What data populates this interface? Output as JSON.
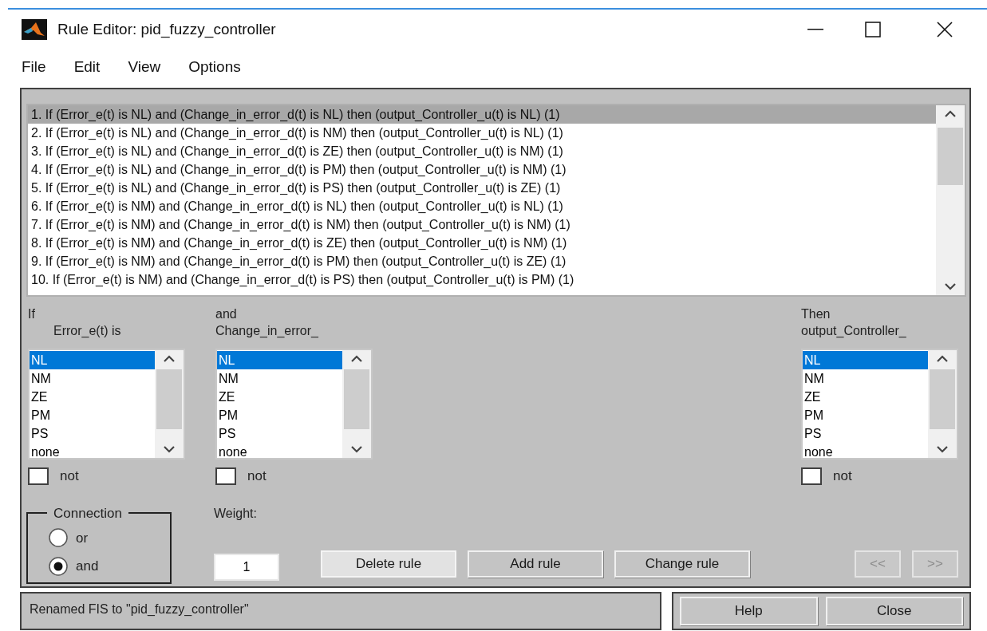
{
  "window": {
    "title": "Rule Editor: pid_fuzzy_controller"
  },
  "menu": [
    "File",
    "Edit",
    "View",
    "Options"
  ],
  "rules": [
    {
      "text": "1. If (Error_e(t) is NL) and (Change_in_error_d(t) is NL) then (output_Controller_u(t) is NL) (1)",
      "selected": true
    },
    {
      "text": "2. If (Error_e(t) is NL) and (Change_in_error_d(t) is NM) then (output_Controller_u(t) is NL) (1)",
      "selected": false
    },
    {
      "text": "3. If (Error_e(t) is NL) and (Change_in_error_d(t) is ZE) then (output_Controller_u(t) is NM) (1)",
      "selected": false
    },
    {
      "text": "4. If (Error_e(t) is NL) and (Change_in_error_d(t) is PM) then (output_Controller_u(t) is NM) (1)",
      "selected": false
    },
    {
      "text": "5. If (Error_e(t) is NL) and (Change_in_error_d(t) is PS) then (output_Controller_u(t) is ZE) (1)",
      "selected": false
    },
    {
      "text": "6. If (Error_e(t) is NM) and (Change_in_error_d(t) is NL) then (output_Controller_u(t) is NL) (1)",
      "selected": false
    },
    {
      "text": "7. If (Error_e(t) is NM) and (Change_in_error_d(t) is NM) then (output_Controller_u(t) is NM) (1)",
      "selected": false
    },
    {
      "text": "8. If (Error_e(t) is NM) and (Change_in_error_d(t) is ZE) then (output_Controller_u(t) is NM) (1)",
      "selected": false
    },
    {
      "text": "9. If (Error_e(t) is NM) and (Change_in_error_d(t) is PM) then (output_Controller_u(t) is ZE) (1)",
      "selected": false
    },
    {
      "text": "10. If (Error_e(t) is NM) and (Change_in_error_d(t) is PS) then (output_Controller_u(t) is PM) (1)",
      "selected": false
    }
  ],
  "variables": [
    {
      "kind": "input",
      "heading": "If",
      "variable": "Error_e(t) is",
      "items": [
        {
          "label": "NL",
          "selected": true
        },
        {
          "label": "NM",
          "selected": false
        },
        {
          "label": "ZE",
          "selected": false
        },
        {
          "label": "PM",
          "selected": false
        },
        {
          "label": "PS",
          "selected": false
        },
        {
          "label": "none",
          "selected": false
        }
      ],
      "not": {
        "label": "not",
        "checked": false
      }
    },
    {
      "kind": "input",
      "heading": "and",
      "variable": "Change_in_error_",
      "items": [
        {
          "label": "NL",
          "selected": true
        },
        {
          "label": "NM",
          "selected": false
        },
        {
          "label": "ZE",
          "selected": false
        },
        {
          "label": "PM",
          "selected": false
        },
        {
          "label": "PS",
          "selected": false
        },
        {
          "label": "none",
          "selected": false
        }
      ],
      "not": {
        "label": "not",
        "checked": false
      }
    },
    {
      "kind": "output",
      "heading": "Then",
      "variable": "output_Controller_",
      "items": [
        {
          "label": "NL",
          "selected": true
        },
        {
          "label": "NM",
          "selected": false
        },
        {
          "label": "ZE",
          "selected": false
        },
        {
          "label": "PM",
          "selected": false
        },
        {
          "label": "PS",
          "selected": false
        },
        {
          "label": "none",
          "selected": false
        }
      ],
      "not": {
        "label": "not",
        "checked": false
      }
    }
  ],
  "connection": {
    "title": "Connection",
    "options": [
      {
        "label": "or",
        "selected": false
      },
      {
        "label": "and",
        "selected": true
      }
    ]
  },
  "weight": {
    "label": "Weight:",
    "value": "1"
  },
  "buttons": [
    {
      "label": "Delete rule",
      "focused": true,
      "disabled": false
    },
    {
      "label": "Add rule",
      "focused": false,
      "disabled": false
    },
    {
      "label": "Change rule",
      "focused": false,
      "disabled": false
    }
  ],
  "nav_buttons": [
    {
      "label": "<<",
      "disabled": true
    },
    {
      "label": ">>",
      "disabled": true
    }
  ],
  "status": "Renamed FIS to \"pid_fuzzy_controller\"",
  "footer_buttons": [
    "Help",
    "Close"
  ]
}
